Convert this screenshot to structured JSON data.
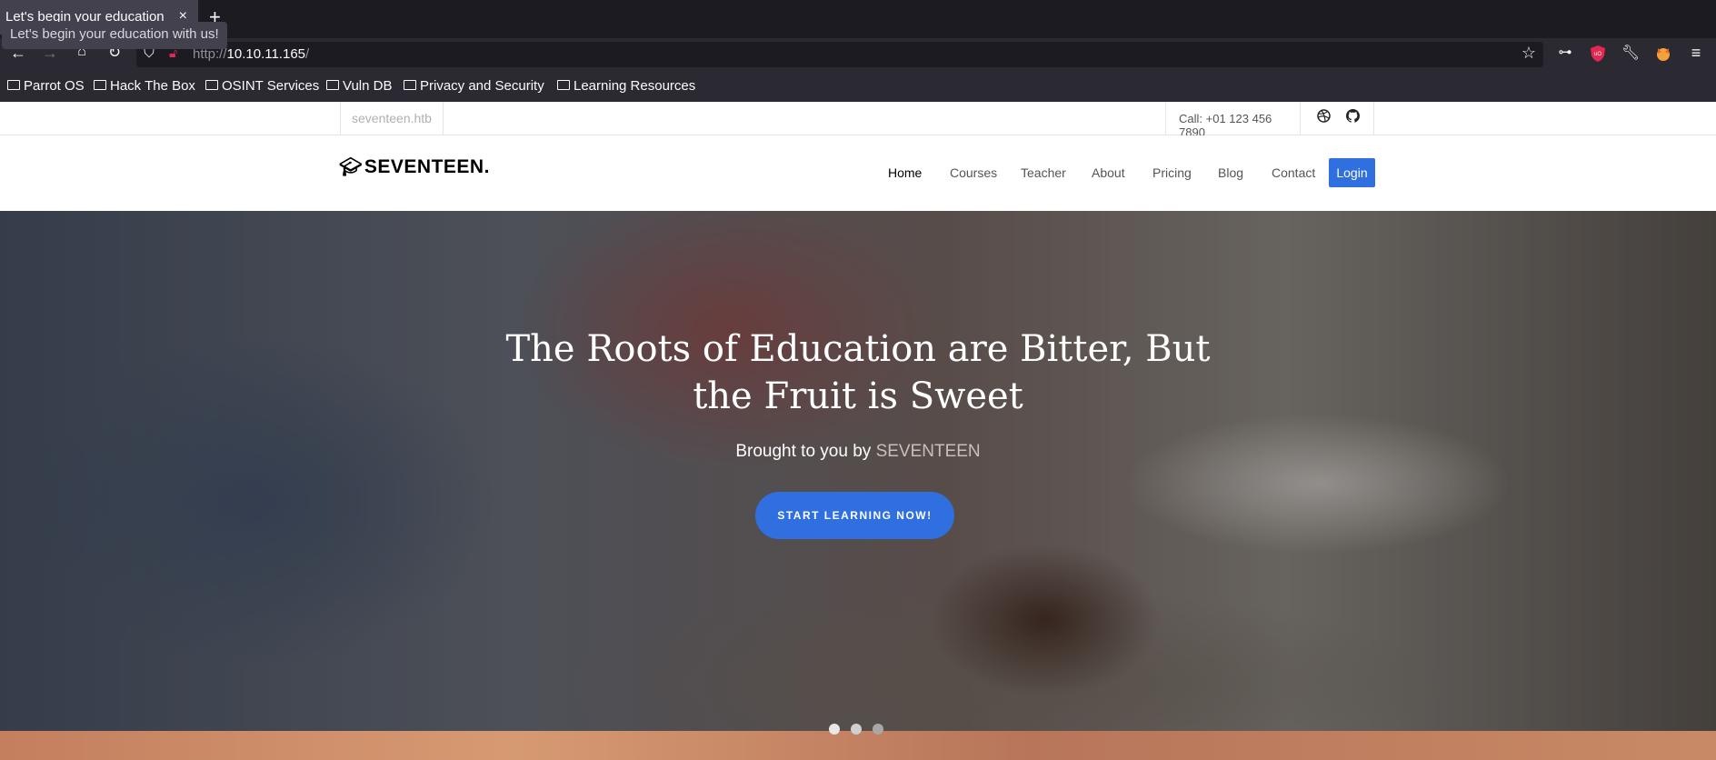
{
  "browser": {
    "tab_title": "Let's begin your education",
    "tab_close": "×",
    "new_tab": "+",
    "tooltip": "Let's begin your education with us!",
    "url_scheme": "http://",
    "url_host": "10.10.11.165",
    "url_path": "/",
    "bookmarks": [
      "Parrot OS",
      "Hack The Box",
      "OSINT Services",
      "Vuln DB",
      "Privacy and Security",
      "Learning Resources"
    ]
  },
  "site": {
    "domain": "seventeen.htb",
    "call": "Call: +01 123 456 7890",
    "logo": "SEVENTEEN.",
    "menu": [
      "Home",
      "Courses",
      "Teacher",
      "About",
      "Pricing",
      "Blog",
      "Contact"
    ],
    "login": "Login",
    "hero": {
      "title_line1": "The Roots of Education are Bitter, But",
      "title_line2": "the Fruit is Sweet",
      "subtitle_prefix": "Brought to you by ",
      "subtitle_brand": "SEVENTEEN",
      "cta": "START LEARNING NOW!"
    },
    "slider": {
      "slides": 3,
      "active_index": 0
    }
  },
  "colors": {
    "accent": "#2f6fe0",
    "tab_bg": "#42414d",
    "chrome_bg": "#2b2a33"
  }
}
